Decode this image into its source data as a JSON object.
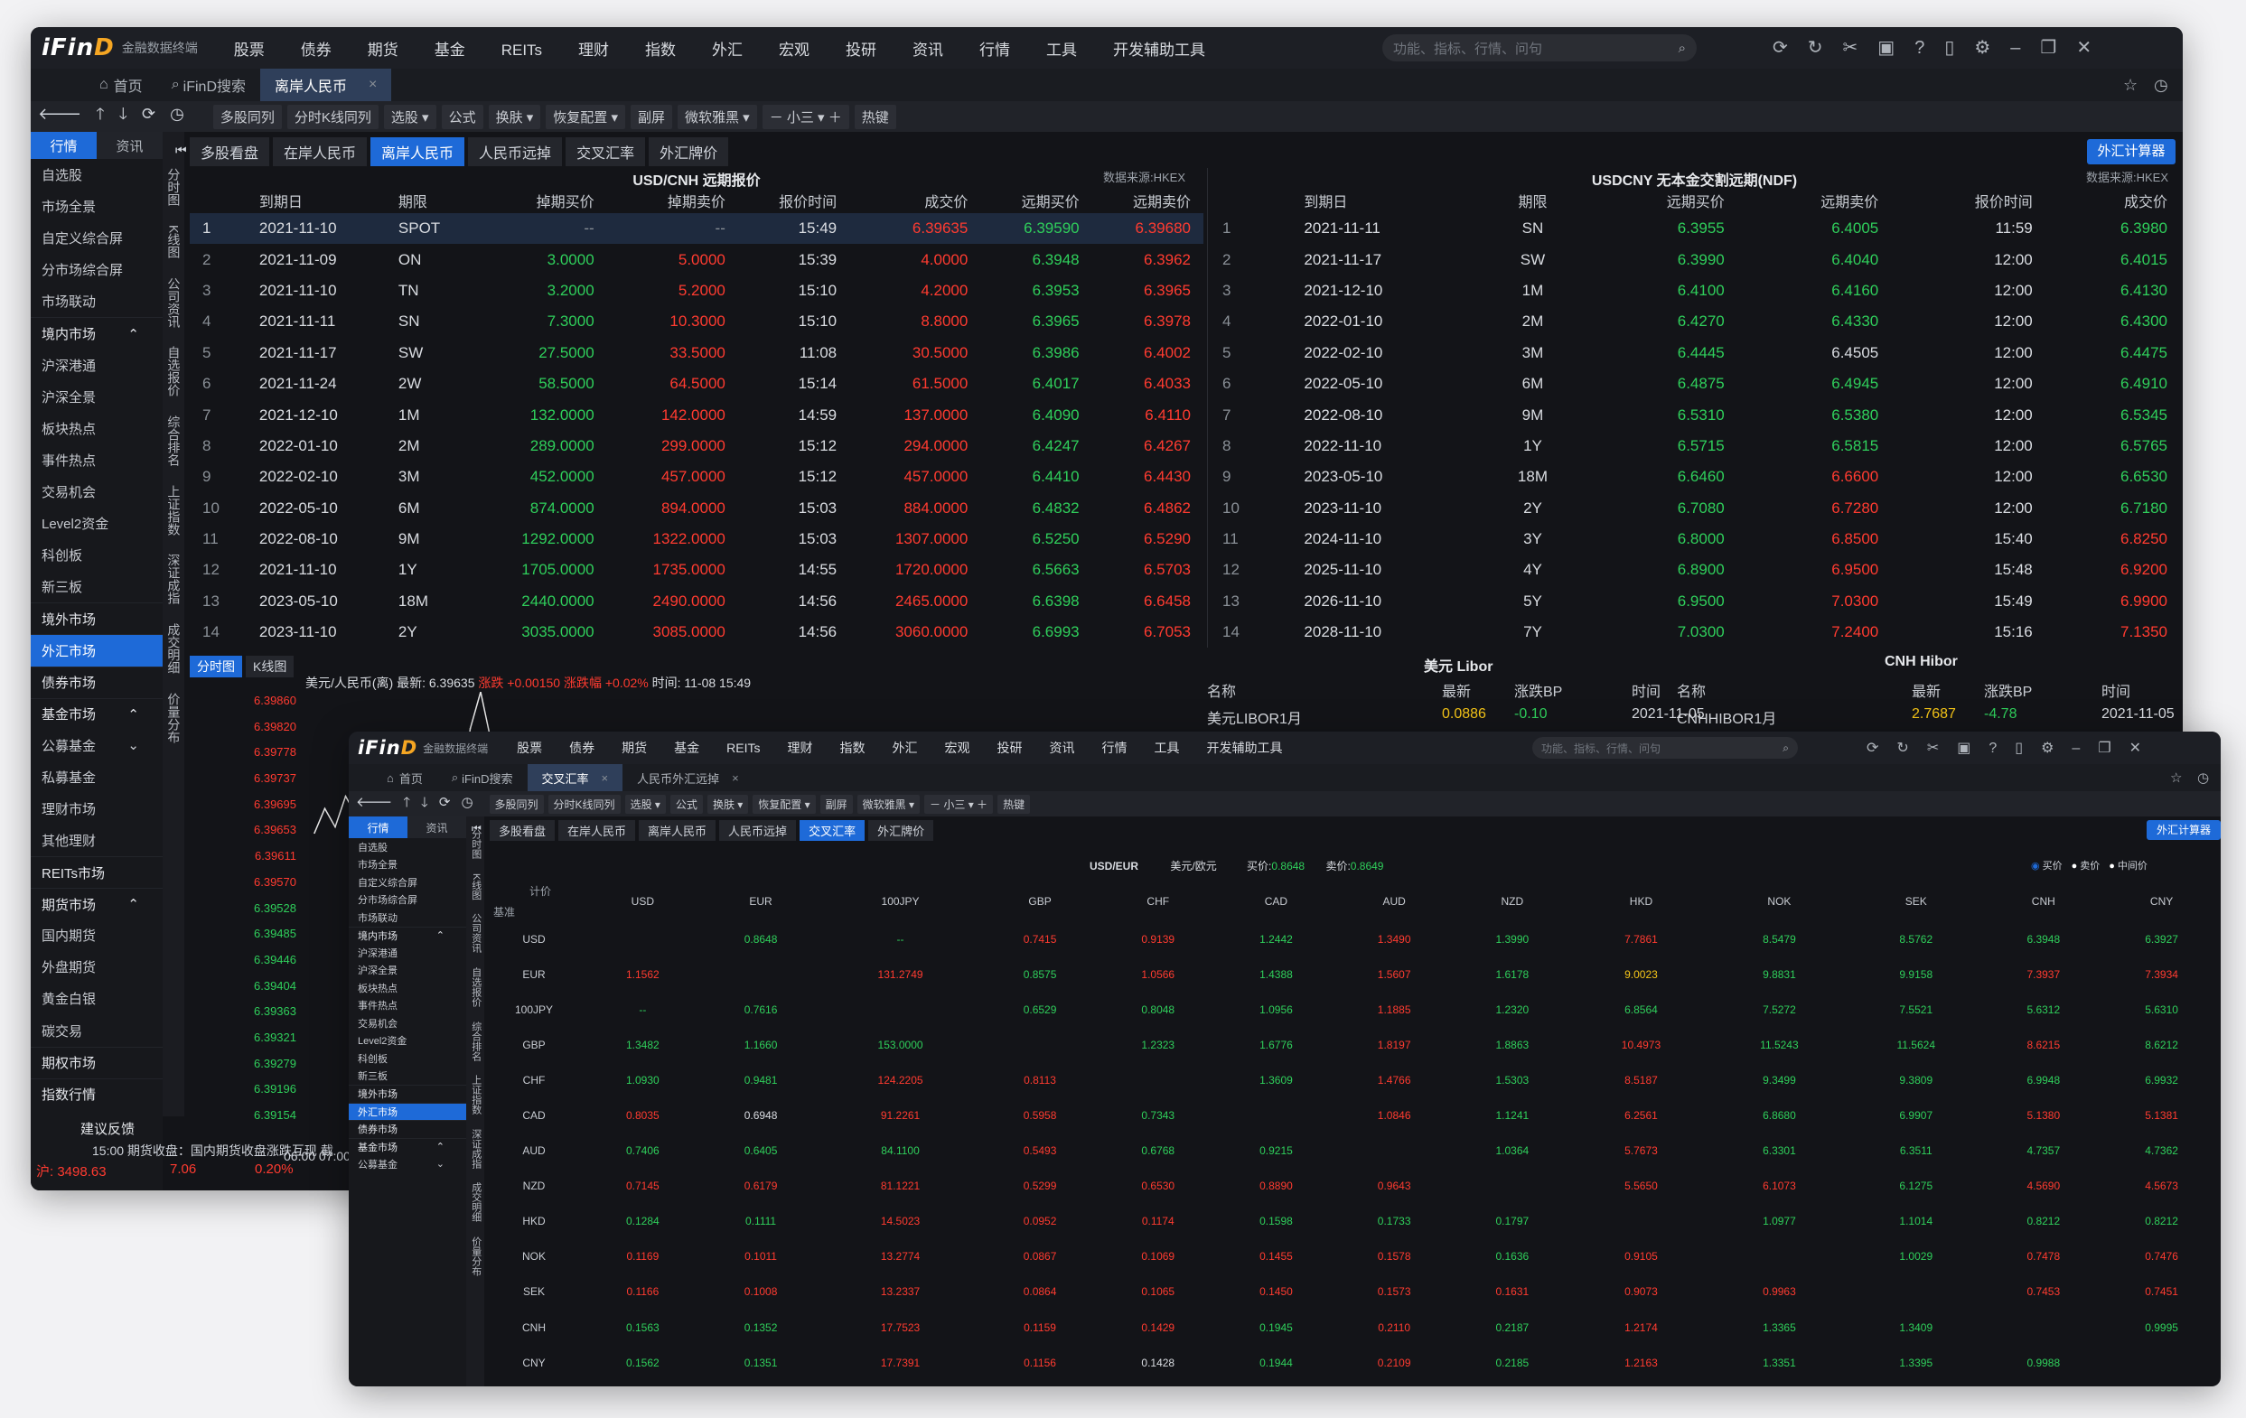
{
  "menu": [
    "股票",
    "债券",
    "期货",
    "基金",
    "REITs",
    "理财",
    "指数",
    "外汇",
    "宏观",
    "投研",
    "资讯",
    "行情",
    "工具",
    "开发辅助工具"
  ],
  "menu_dots": [
    true,
    true,
    true,
    true,
    false,
    true,
    false,
    false,
    true,
    true,
    true,
    true,
    false,
    false
  ],
  "app": {
    "logo": "iFinD",
    "subtitle": "金融数据终端",
    "search_placeholder": "功能、指标、行情、问句"
  },
  "w1": {
    "tabs": [
      "首页",
      "iFinD搜索",
      "离岸人民币"
    ],
    "toolbar": [
      "多股同列",
      "分时K线同列",
      "选股 ▾",
      "公式",
      "换肤 ▾",
      "恢复配置 ▾",
      "副屏",
      "微软雅黑 ▾",
      "－ 小三 ▾ ＋",
      "热键"
    ],
    "side_tabs": [
      "行情",
      "资讯"
    ],
    "sidebar": [
      {
        "t": "自选股"
      },
      {
        "t": "市场全景"
      },
      {
        "t": "自定义综合屏"
      },
      {
        "t": "分市场综合屏"
      },
      {
        "t": "市场联动"
      },
      {
        "t": "境内市场",
        "c": "⌃",
        "s": 1
      },
      {
        "t": "沪深港通"
      },
      {
        "t": "沪深全景"
      },
      {
        "t": "板块热点"
      },
      {
        "t": "事件热点"
      },
      {
        "t": "交易机会"
      },
      {
        "t": "Level2资金"
      },
      {
        "t": "科创板"
      },
      {
        "t": "新三板"
      },
      {
        "t": "境外市场",
        "s": 1
      },
      {
        "t": "外汇市场",
        "s": 1,
        "sel": 1
      },
      {
        "t": "债券市场",
        "s": 1
      },
      {
        "t": "基金市场",
        "c": "⌃",
        "s": 1
      },
      {
        "t": "公募基金",
        "c": "⌄"
      },
      {
        "t": "私募基金"
      },
      {
        "t": "理财市场"
      },
      {
        "t": "其他理财"
      },
      {
        "t": "REITs市场",
        "s": 1
      },
      {
        "t": "期货市场",
        "c": "⌃",
        "s": 1
      },
      {
        "t": "国内期货"
      },
      {
        "t": "外盘期货"
      },
      {
        "t": "黄金白银"
      },
      {
        "t": "碳交易"
      },
      {
        "t": "期权市场",
        "s": 1
      },
      {
        "t": "指数行情",
        "s": 1
      }
    ],
    "vstrip": [
      "分时图",
      "K线图",
      "公司资讯",
      "自选报价",
      "综合排名",
      "上证指数",
      "深证成指",
      "成交明细",
      "价量分布"
    ],
    "subtabs": [
      "多股看盘",
      "在岸人民币",
      "离岸人民币",
      "人民币远掉",
      "交叉汇率",
      "外汇牌价"
    ],
    "calc_button": "外汇计算器",
    "left_title": "USD/CNH 远期报价",
    "right_title": "USDCNY 无本金交割远期(NDF)",
    "source": "数据来源:HKEX",
    "left_headers": [
      "",
      "到期日",
      "期限",
      "掉期买价",
      "掉期卖价",
      "报价时间",
      "成交价",
      "远期买价",
      "远期卖价"
    ],
    "left_rows": [
      [
        "1",
        "2021-11-10",
        "SPOT",
        "--",
        "--",
        "15:49",
        "6.39635",
        "6.39590",
        "6.39680"
      ],
      [
        "2",
        "2021-11-09",
        "ON",
        "3.0000",
        "5.0000",
        "15:39",
        "4.0000",
        "6.3948",
        "6.3962"
      ],
      [
        "3",
        "2021-11-10",
        "TN",
        "3.2000",
        "5.2000",
        "15:10",
        "4.2000",
        "6.3953",
        "6.3965"
      ],
      [
        "4",
        "2021-11-11",
        "SN",
        "7.3000",
        "10.3000",
        "15:10",
        "8.8000",
        "6.3965",
        "6.3978"
      ],
      [
        "5",
        "2021-11-17",
        "SW",
        "27.5000",
        "33.5000",
        "11:08",
        "30.5000",
        "6.3986",
        "6.4002"
      ],
      [
        "6",
        "2021-11-24",
        "2W",
        "58.5000",
        "64.5000",
        "15:14",
        "61.5000",
        "6.4017",
        "6.4033"
      ],
      [
        "7",
        "2021-12-10",
        "1M",
        "132.0000",
        "142.0000",
        "14:59",
        "137.0000",
        "6.4090",
        "6.4110"
      ],
      [
        "8",
        "2022-01-10",
        "2M",
        "289.0000",
        "299.0000",
        "15:12",
        "294.0000",
        "6.4247",
        "6.4267"
      ],
      [
        "9",
        "2022-02-10",
        "3M",
        "452.0000",
        "457.0000",
        "15:12",
        "457.0000",
        "6.4410",
        "6.4430"
      ],
      [
        "10",
        "2022-05-10",
        "6M",
        "874.0000",
        "894.0000",
        "15:03",
        "884.0000",
        "6.4832",
        "6.4862"
      ],
      [
        "11",
        "2022-08-10",
        "9M",
        "1292.0000",
        "1322.0000",
        "15:03",
        "1307.0000",
        "6.5250",
        "6.5290"
      ],
      [
        "12",
        "2021-11-10",
        "1Y",
        "1705.0000",
        "1735.0000",
        "14:55",
        "1720.0000",
        "6.5663",
        "6.5703"
      ],
      [
        "13",
        "2023-05-10",
        "18M",
        "2440.0000",
        "2490.0000",
        "14:56",
        "2465.0000",
        "6.6398",
        "6.6458"
      ],
      [
        "14",
        "2023-11-10",
        "2Y",
        "3035.0000",
        "3085.0000",
        "14:56",
        "3060.0000",
        "6.6993",
        "6.7053"
      ]
    ],
    "left_colors": [
      "gr",
      "w",
      "w",
      "g",
      "r",
      "w",
      "r",
      "g",
      "r"
    ],
    "right_headers": [
      "",
      "到期日",
      "期限",
      "远期买价",
      "远期卖价",
      "报价时间",
      "成交价"
    ],
    "right_rows": [
      [
        "1",
        "2021-11-11",
        "SN",
        "6.3955",
        "6.4005",
        "11:59",
        "6.3980"
      ],
      [
        "2",
        "2021-11-17",
        "SW",
        "6.3990",
        "6.4040",
        "12:00",
        "6.4015"
      ],
      [
        "3",
        "2021-12-10",
        "1M",
        "6.4100",
        "6.4160",
        "12:00",
        "6.4130"
      ],
      [
        "4",
        "2022-01-10",
        "2M",
        "6.4270",
        "6.4330",
        "12:00",
        "6.4300"
      ],
      [
        "5",
        "2022-02-10",
        "3M",
        "6.4445",
        "6.4505",
        "12:00",
        "6.4475"
      ],
      [
        "6",
        "2022-05-10",
        "6M",
        "6.4875",
        "6.4945",
        "12:00",
        "6.4910"
      ],
      [
        "7",
        "2022-08-10",
        "9M",
        "6.5310",
        "6.5380",
        "12:00",
        "6.5345"
      ],
      [
        "8",
        "2022-11-10",
        "1Y",
        "6.5715",
        "6.5815",
        "12:00",
        "6.5765"
      ],
      [
        "9",
        "2023-05-10",
        "18M",
        "6.6460",
        "6.6600",
        "12:00",
        "6.6530"
      ],
      [
        "10",
        "2023-11-10",
        "2Y",
        "6.7080",
        "6.7280",
        "12:00",
        "6.7180"
      ],
      [
        "11",
        "2024-11-10",
        "3Y",
        "6.8000",
        "6.8500",
        "15:40",
        "6.8250"
      ],
      [
        "12",
        "2025-11-10",
        "4Y",
        "6.8900",
        "6.9500",
        "15:48",
        "6.9200"
      ],
      [
        "13",
        "2026-11-10",
        "5Y",
        "6.9500",
        "7.0300",
        "15:49",
        "6.9900"
      ],
      [
        "14",
        "2028-11-10",
        "7Y",
        "7.0300",
        "7.2400",
        "15:16",
        "7.1350"
      ]
    ],
    "right_colors": [
      [
        "gr",
        "w",
        "w",
        "g",
        "g",
        "w",
        "g"
      ],
      [
        "gr",
        "w",
        "w",
        "g",
        "g",
        "w",
        "g"
      ],
      [
        "gr",
        "w",
        "w",
        "g",
        "g",
        "w",
        "g"
      ],
      [
        "gr",
        "w",
        "w",
        "g",
        "g",
        "w",
        "g"
      ],
      [
        "gr",
        "w",
        "w",
        "g",
        "w",
        "w",
        "g"
      ],
      [
        "gr",
        "w",
        "w",
        "g",
        "g",
        "w",
        "g"
      ],
      [
        "gr",
        "w",
        "w",
        "g",
        "g",
        "w",
        "g"
      ],
      [
        "gr",
        "w",
        "w",
        "g",
        "g",
        "w",
        "g"
      ],
      [
        "gr",
        "w",
        "w",
        "g",
        "r",
        "w",
        "g"
      ],
      [
        "gr",
        "w",
        "w",
        "g",
        "r",
        "w",
        "g"
      ],
      [
        "gr",
        "w",
        "w",
        "g",
        "r",
        "w",
        "r"
      ],
      [
        "gr",
        "w",
        "w",
        "g",
        "r",
        "w",
        "r"
      ],
      [
        "gr",
        "w",
        "w",
        "g",
        "r",
        "w",
        "r"
      ],
      [
        "gr",
        "w",
        "w",
        "g",
        "r",
        "w",
        "r"
      ]
    ],
    "chart_tabs": [
      "分时图",
      "K线图"
    ],
    "chart_info": [
      {
        "t": "美元/人民币(离) 最新: 6.39635 ",
        "c": "w"
      },
      {
        "t": "涨跌 ",
        "c": "r"
      },
      {
        "t": "+0.00150 ",
        "c": "r"
      },
      {
        "t": "涨跌幅 ",
        "c": "r"
      },
      {
        "t": "+0.02% ",
        "c": "r"
      },
      {
        "t": "时间: 11-08 15:49",
        "c": "w"
      }
    ],
    "y_ticks": [
      "6.39860",
      "6.39820",
      "6.39778",
      "6.39737",
      "6.39695",
      "6.39653",
      "6.39611",
      "6.39570",
      "6.39528",
      "6.39485",
      "6.39446",
      "6.39404",
      "6.39363",
      "6.39321",
      "6.39279",
      "6.39196",
      "6.39154"
    ],
    "x_ticks": "06:00 07:00 08",
    "chart_data": {
      "type": "line",
      "x": [
        0,
        1,
        2,
        3,
        4,
        5,
        6,
        7,
        8,
        9,
        10,
        11,
        12,
        13,
        14,
        15,
        16,
        17,
        18,
        19,
        20
      ],
      "y": [
        6.3963,
        6.3967,
        6.3964,
        6.3969,
        6.3966,
        6.397,
        6.3968,
        6.3974,
        6.3971,
        6.3973,
        6.3969,
        6.3972,
        6.3967,
        6.3965,
        6.3968,
        6.398,
        6.3986,
        6.3978,
        6.3975,
        6.3972,
        6.3974
      ],
      "ylim": [
        6.39154,
        6.3986
      ]
    },
    "libor": {
      "title": "美元 Libor",
      "headers": [
        "名称",
        "最新",
        "涨跌BP",
        "时间"
      ],
      "row": [
        "美元LIBOR1月",
        "0.0886",
        "-0.10",
        "2021-11-05"
      ]
    },
    "hibor": {
      "title": "CNH Hibor",
      "headers": [
        "名称",
        "最新",
        "涨跌BP",
        "时间"
      ],
      "row": [
        "CNHHIBOR1月",
        "2.7687",
        "-4.78",
        "2021-11-05"
      ]
    },
    "feedback": "建议反馈",
    "ticker": "15:00 期货收盘：国内期货收盘涨跌互现 截",
    "status": [
      "沪: 3498.63",
      "7.06",
      "0.20%"
    ]
  },
  "w2": {
    "tabs": [
      "首页",
      "iFinD搜索",
      "交叉汇率",
      "人民币外汇远掉"
    ],
    "subtabs": [
      "多股看盘",
      "在岸人民币",
      "离岸人民币",
      "人民币远掉",
      "交叉汇率",
      "外汇牌价"
    ],
    "pair": "USD/EUR",
    "pair_name": "美元/欧元",
    "buy_label": "买价:",
    "buy": "0.8648",
    "sell_label": "卖价:",
    "sell": "0.8649",
    "radios": [
      "买价",
      "卖价",
      "中间价"
    ],
    "corner": [
      "计价",
      "基准"
    ],
    "cols": [
      "USD",
      "EUR",
      "100JPY",
      "GBP",
      "CHF",
      "CAD",
      "AUD",
      "NZD",
      "HKD",
      "NOK",
      "SEK",
      "CNH",
      "CNY"
    ],
    "rows": [
      {
        "h": "USD",
        "v": [
          "",
          "0.8648",
          "--",
          "0.7415",
          "0.9139",
          "1.2442",
          "1.3490",
          "1.3990",
          "7.7861",
          "8.5479",
          "8.5762",
          "6.3948",
          "6.3927"
        ]
      },
      {
        "h": "EUR",
        "v": [
          "1.1562",
          "",
          "131.2749",
          "0.8575",
          "1.0566",
          "1.4388",
          "1.5607",
          "1.6178",
          "9.0023",
          "9.8831",
          "9.9158",
          "7.3937",
          "7.3934"
        ]
      },
      {
        "h": "100JPY",
        "v": [
          "--",
          "0.7616",
          "",
          "0.6529",
          "0.8048",
          "1.0956",
          "1.1885",
          "1.2320",
          "6.8564",
          "7.5272",
          "7.5521",
          "5.6312",
          "5.6310"
        ]
      },
      {
        "h": "GBP",
        "v": [
          "1.3482",
          "1.1660",
          "153.0000",
          "",
          "1.2323",
          "1.6776",
          "1.8197",
          "1.8863",
          "10.4973",
          "11.5243",
          "11.5624",
          "8.6215",
          "8.6212"
        ]
      },
      {
        "h": "CHF",
        "v": [
          "1.0930",
          "0.9481",
          "124.2205",
          "0.8113",
          "",
          "1.3609",
          "1.4766",
          "1.5303",
          "8.5187",
          "9.3499",
          "9.3809",
          "6.9948",
          "6.9932"
        ]
      },
      {
        "h": "CAD",
        "v": [
          "0.8035",
          "0.6948",
          "91.2261",
          "0.5958",
          "0.7343",
          "",
          "1.0846",
          "1.1241",
          "6.2561",
          "6.8680",
          "6.9907",
          "5.1380",
          "5.1381"
        ]
      },
      {
        "h": "AUD",
        "v": [
          "0.7406",
          "0.6405",
          "84.1100",
          "0.5493",
          "0.6768",
          "0.9215",
          "",
          "1.0364",
          "5.7673",
          "6.3301",
          "6.3511",
          "4.7357",
          "4.7362"
        ]
      },
      {
        "h": "NZD",
        "v": [
          "0.7145",
          "0.6179",
          "81.1221",
          "0.5299",
          "0.6530",
          "0.8890",
          "0.9643",
          "",
          "5.5650",
          "6.1073",
          "6.1275",
          "4.5690",
          "4.5673"
        ]
      },
      {
        "h": "HKD",
        "v": [
          "0.1284",
          "0.1111",
          "14.5023",
          "0.0952",
          "0.1174",
          "0.1598",
          "0.1733",
          "0.1797",
          "",
          "1.0977",
          "1.1014",
          "0.8212",
          "0.8212"
        ]
      },
      {
        "h": "NOK",
        "v": [
          "0.1169",
          "0.1011",
          "13.2774",
          "0.0867",
          "0.1069",
          "0.1455",
          "0.1578",
          "0.1636",
          "0.9105",
          "",
          "1.0029",
          "0.7478",
          "0.7476"
        ]
      },
      {
        "h": "SEK",
        "v": [
          "0.1166",
          "0.1008",
          "13.2337",
          "0.0864",
          "0.1065",
          "0.1450",
          "0.1573",
          "0.1631",
          "0.9073",
          "0.9963",
          "",
          "0.7453",
          "0.7451"
        ]
      },
      {
        "h": "CNH",
        "v": [
          "0.1563",
          "0.1352",
          "17.7523",
          "0.1159",
          "0.1429",
          "0.1945",
          "0.2110",
          "0.2187",
          "1.2174",
          "1.3365",
          "1.3409",
          "",
          "0.9995"
        ]
      },
      {
        "h": "CNY",
        "v": [
          "0.1562",
          "0.1351",
          "17.7391",
          "0.1156",
          "0.1428",
          "0.1944",
          "0.2109",
          "0.2185",
          "1.2163",
          "1.3351",
          "1.3395",
          "0.9988",
          ""
        ]
      }
    ],
    "colors": [
      [
        "",
        "g",
        "g",
        "r",
        "r",
        "g",
        "r",
        "g",
        "r",
        "g",
        "g",
        "g",
        "g"
      ],
      [
        "r",
        "",
        "r",
        "g",
        "r",
        "g",
        "r",
        "g",
        "y",
        "g",
        "g",
        "r",
        "r"
      ],
      [
        "g",
        "g",
        "",
        "g",
        "g",
        "g",
        "r",
        "g",
        "g",
        "g",
        "g",
        "g",
        "g"
      ],
      [
        "g",
        "g",
        "g",
        "",
        "g",
        "g",
        "r",
        "g",
        "r",
        "g",
        "g",
        "r",
        "g"
      ],
      [
        "g",
        "g",
        "r",
        "r",
        "",
        "g",
        "r",
        "g",
        "r",
        "g",
        "g",
        "g",
        "g"
      ],
      [
        "r",
        "w",
        "r",
        "r",
        "g",
        "",
        "r",
        "g",
        "r",
        "g",
        "g",
        "r",
        "r"
      ],
      [
        "g",
        "g",
        "g",
        "r",
        "g",
        "g",
        "",
        "g",
        "r",
        "g",
        "g",
        "g",
        "g"
      ],
      [
        "r",
        "r",
        "r",
        "r",
        "r",
        "r",
        "r",
        "",
        "r",
        "r",
        "g",
        "r",
        "r"
      ],
      [
        "g",
        "g",
        "r",
        "r",
        "r",
        "g",
        "g",
        "g",
        "",
        "g",
        "g",
        "g",
        "g"
      ],
      [
        "r",
        "r",
        "r",
        "r",
        "r",
        "r",
        "r",
        "g",
        "r",
        "",
        "g",
        "r",
        "r"
      ],
      [
        "r",
        "r",
        "r",
        "r",
        "r",
        "r",
        "r",
        "r",
        "r",
        "r",
        "",
        "r",
        "r"
      ],
      [
        "g",
        "g",
        "r",
        "r",
        "r",
        "g",
        "r",
        "g",
        "r",
        "g",
        "g",
        "",
        "g"
      ],
      [
        "g",
        "g",
        "r",
        "r",
        "w",
        "g",
        "r",
        "g",
        "r",
        "g",
        "g",
        "g",
        ""
      ]
    ]
  }
}
